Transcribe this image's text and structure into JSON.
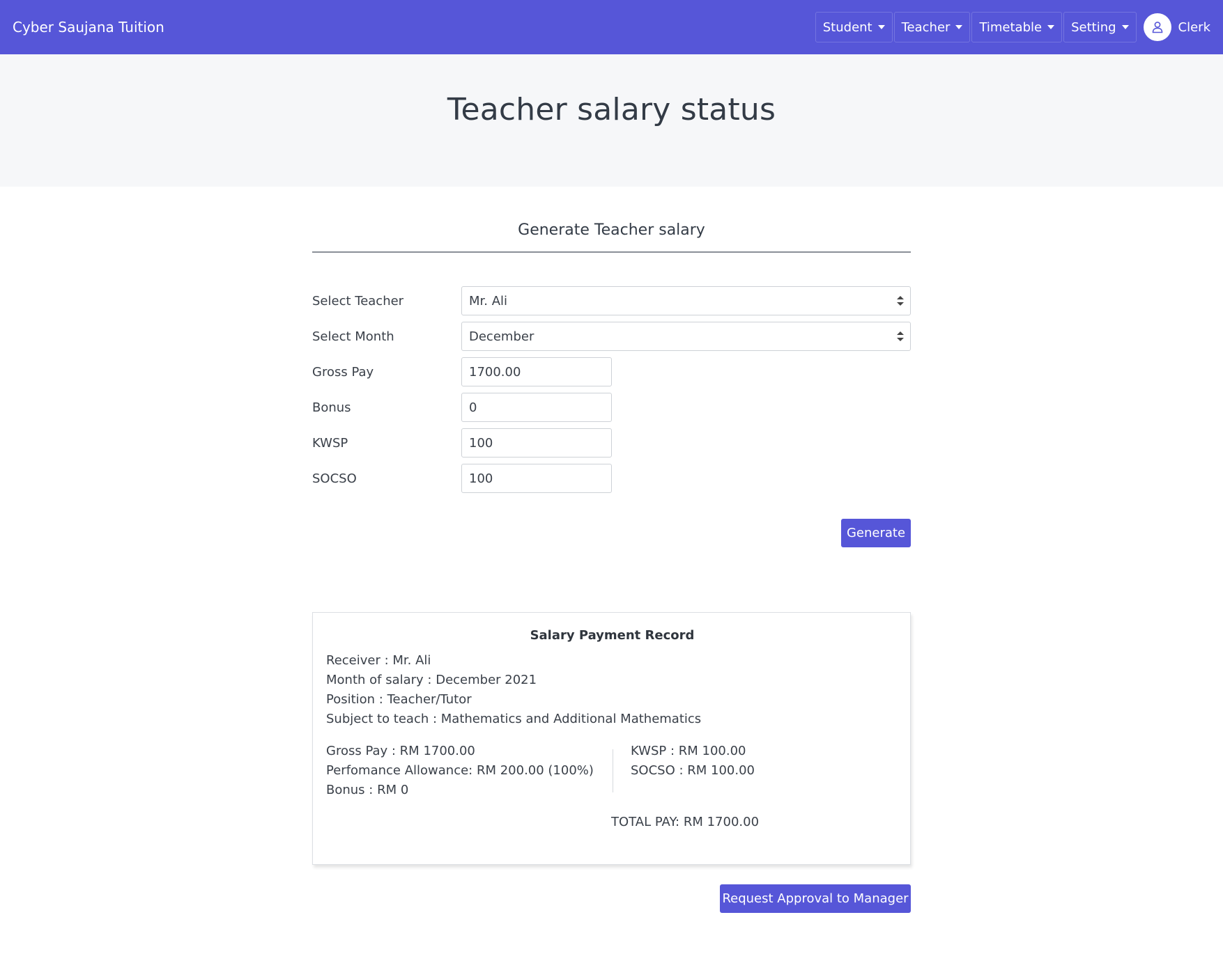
{
  "navbar": {
    "brand": "Cyber Saujana Tuition",
    "menu": [
      {
        "label": "Student"
      },
      {
        "label": "Teacher"
      },
      {
        "label": "Timetable"
      },
      {
        "label": "Setting"
      }
    ],
    "user": "Clerk",
    "color": "#5656d8"
  },
  "page": {
    "title": "Teacher salary status"
  },
  "form": {
    "title": "Generate Teacher salary",
    "teacher": {
      "label": "Select Teacher",
      "value": "Mr. Ali"
    },
    "month": {
      "label": "Select Month",
      "value": "December"
    },
    "gross_pay": {
      "label": "Gross Pay",
      "value": "1700.00"
    },
    "bonus": {
      "label": "Bonus",
      "value": "0"
    },
    "kwsp": {
      "label": "KWSP",
      "value": "100"
    },
    "socso": {
      "label": "SOCSO",
      "value": "100"
    },
    "generate_label": "Generate"
  },
  "record": {
    "title": "Salary Payment Record",
    "receiver": "Receiver : Mr. Ali",
    "month": "Month of salary : December 2021",
    "position": "Position : Teacher/Tutor",
    "subject": "Subject to teach : Mathematics and Additional Mathematics",
    "gross_pay": "Gross Pay : RM 1700.00",
    "allowance": "Perfomance Allowance: RM 200.00 (100%)",
    "bonus": "Bonus : RM 0",
    "kwsp": "KWSP : RM 100.00",
    "socso": "SOCSO : RM 100.00",
    "total": "TOTAL PAY: RM 1700.00"
  },
  "actions": {
    "request_label": "Request Approval to Manager"
  }
}
